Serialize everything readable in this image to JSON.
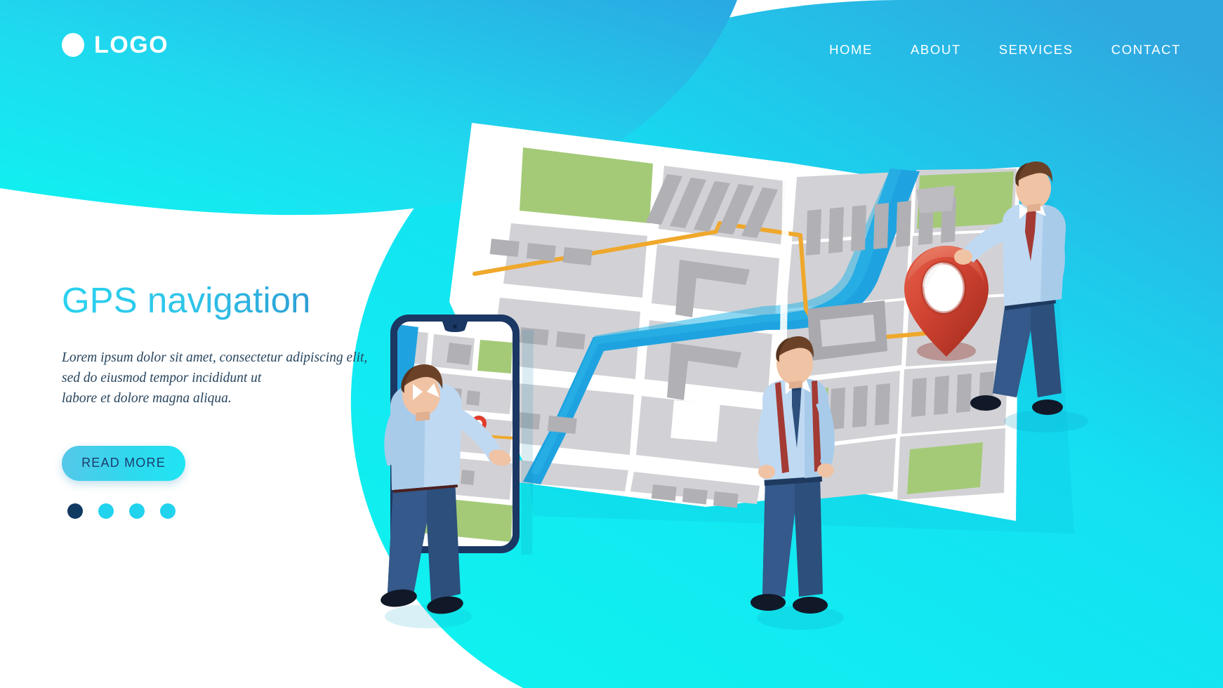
{
  "page": {
    "title": "GPS navigation",
    "type": "landing-page-hero"
  },
  "brand": {
    "logo_text": "LOGO",
    "logo_mark_icon": "circle-icon",
    "logo_color": "#ffffff"
  },
  "nav": {
    "items": [
      {
        "label": "HOME"
      },
      {
        "label": "ABOUT"
      },
      {
        "label": "SERVICES"
      },
      {
        "label": "CONTACT"
      }
    ]
  },
  "hero": {
    "title": "GPS navigation",
    "desc_line1": "Lorem ipsum dolor sit amet, consectetur adipiscing elit,",
    "desc_line2": "sed do eiusmod tempor incididunt ut",
    "desc_line3": "labore et dolore magna aliqua.",
    "cta_label": "READ MORE",
    "carousel_dots": [
      {
        "color": "#113a63",
        "active": true
      },
      {
        "color": "#22d3ee",
        "active": false
      },
      {
        "color": "#22d3ee",
        "active": false
      },
      {
        "color": "#22d3ee",
        "active": false
      }
    ]
  },
  "illustration": {
    "map_alt": "folded-isometric-city-map",
    "phone_alt": "smartphone-showing-map",
    "pin_alt": "3d-red-location-pin",
    "people": [
      {
        "name": "man-with-phone",
        "shirt": "#b6d3ef",
        "trousers": "#2c4f7c"
      },
      {
        "name": "man-with-suspenders",
        "shirt": "#bfd9f2",
        "trousers": "#2c4f7c"
      },
      {
        "name": "man-leaning-on-pin",
        "shirt": "#bfd9f2",
        "trousers": "#2c4f7c"
      }
    ]
  },
  "colors": {
    "cyan_bright": "#19e3f0",
    "cyan_mid": "#25c6e8",
    "blue_deep": "#2196d8",
    "accent_red": "#c8392b",
    "route_orange": "#efa82c",
    "park_green": "#a4ca78",
    "river_blue": "#1fa3e0",
    "building_gray": "#c9c9cd",
    "text_dark": "#28455e",
    "white": "#ffffff"
  }
}
